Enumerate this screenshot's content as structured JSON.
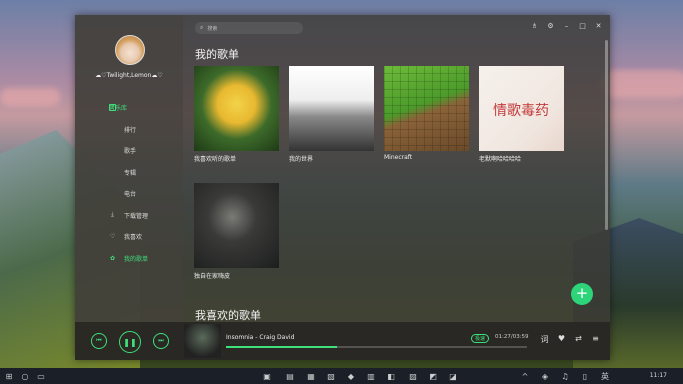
{
  "user": {
    "name": "☁︎♡Twilight,Lemon☁︎♡"
  },
  "search": {
    "placeholder": "搜索"
  },
  "sidebar": {
    "items": [
      {
        "label": "音乐库",
        "icon": "music-library-icon"
      },
      {
        "label": "排行",
        "icon": ""
      },
      {
        "label": "歌手",
        "icon": ""
      },
      {
        "label": "专辑",
        "icon": ""
      },
      {
        "label": "电台",
        "icon": ""
      },
      {
        "label": "下载管理",
        "icon": "download-icon"
      },
      {
        "label": "我喜欢",
        "icon": "heart-icon"
      },
      {
        "label": "我的歌单",
        "icon": "playlist-icon"
      }
    ]
  },
  "main": {
    "section1_title": "我的歌单",
    "section2_title": "我喜欢的歌单",
    "playlists": [
      {
        "name": "我喜欢听的歌单"
      },
      {
        "name": "我的世界"
      },
      {
        "name": "Minecraft"
      },
      {
        "name": "老默啊哈哈哈哈"
      },
      {
        "name": "独自在家嗨皮"
      }
    ],
    "cover_text": "情歌毒药"
  },
  "player": {
    "track": "Insomnia - Craig David",
    "quality": "极速",
    "time": "01:27/03:59",
    "progress": 0.37,
    "lyrics_label": "词"
  },
  "taskbar": {
    "time": "11:17"
  },
  "colors": {
    "accent": "#3ee07a",
    "fab": "#2ed47a"
  }
}
